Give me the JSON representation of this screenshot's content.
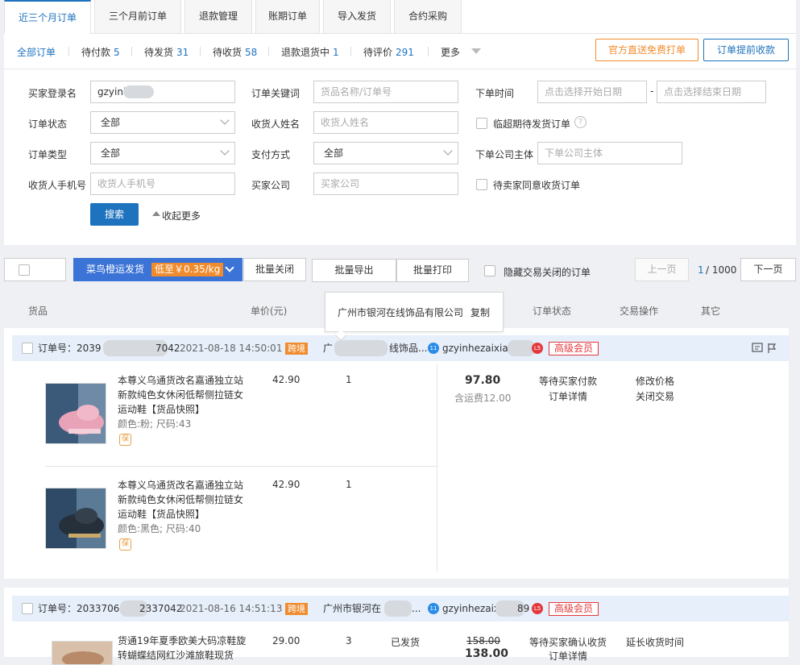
{
  "tabs": [
    {
      "label": "近三个月订单",
      "active": true
    },
    {
      "label": "三个月前订单"
    },
    {
      "label": "退款管理"
    },
    {
      "label": "账期订单"
    },
    {
      "label": "导入发货"
    },
    {
      "label": "合约采购"
    }
  ],
  "status": {
    "all": "全部订单",
    "items": [
      {
        "label": "待付款",
        "count": "5"
      },
      {
        "label": "待发货",
        "count": "31"
      },
      {
        "label": "待收货",
        "count": "58"
      },
      {
        "label": "退款退货中",
        "count": "1"
      },
      {
        "label": "待评价",
        "count": "291"
      }
    ],
    "more": "更多",
    "print_btn": "官方直送免费打单",
    "collect_btn": "订单提前收款"
  },
  "filter": {
    "buyer_login_label": "买家登录名",
    "buyer_login_value": "gzyinh an",
    "keyword_label": "订单关键词",
    "keyword_placeholder": "货品名称/订单号",
    "time_label": "下单时间",
    "start_placeholder": "点击选择开始日期",
    "dash": "-",
    "end_placeholder": "点击选择结束日期",
    "status_label": "订单状态",
    "status_value": "全部",
    "receiver_label": "收货人姓名",
    "receiver_placeholder": "收货人姓名",
    "overdue_label": "临超期待发货订单",
    "help_icon": "?",
    "type_label": "订单类型",
    "type_value": "全部",
    "pay_label": "支付方式",
    "pay_value": "全部",
    "company_label": "下单公司主体",
    "company_placeholder": "下单公司主体",
    "phone_label": "收货人手机号",
    "phone_placeholder": "收货人手机号",
    "buyer_company_label": "买家公司",
    "buyer_company_placeholder": "买家公司",
    "agree_label": "待卖家同意收货订单",
    "search_btn": "搜索",
    "collapse": "收起更多"
  },
  "batch": {
    "cainiao": "菜鸟橙运发货",
    "cainiao_promo": "低至￥0.35/kg",
    "batch_close": "批量关闭",
    "batch_export": "批量导出",
    "batch_print": "批量打印",
    "hide_closed": "隐藏交易关闭的订单",
    "prev": "上一页",
    "page_current": "1",
    "page_total": "/ 1000",
    "next": "下一页"
  },
  "table_head": {
    "goods": "货品",
    "price": "单价(元)",
    "order_status": "订单状态",
    "trade_ops": "交易操作",
    "other": "其它"
  },
  "tooltip": {
    "company": "广州市银河在线饰品有限公司",
    "copy": "复制"
  },
  "orders": [
    {
      "no_label": "订单号：",
      "no_part1": "2039",
      "no_part2": "7042",
      "time": "2021-08-18 14:50:01",
      "tag": "跨境",
      "seller_a": "广",
      "seller_b": "线饰品...",
      "buyer": "gzyinhezaixian",
      "member": "高级会员",
      "items": [
        {
          "title": "本尊义乌通货改名嘉通独立站新款纯色女休闲低帮侧拉链女运动鞋【货品快照】",
          "attrs": "颜色:粉; 尺码:43",
          "price": "42.90",
          "qty": "1",
          "img_color": "#e8a3b8"
        },
        {
          "title": "本尊义乌通货改名嘉通独立站新款纯色女休闲低帮侧拉链女运动鞋【货品快照】",
          "attrs": "颜色:黑色; 尺码:40",
          "price": "42.90",
          "qty": "1",
          "img_color": "#2c3a4a"
        }
      ],
      "total": "97.80",
      "shipping": "含运费12.00",
      "status_main": "等待买家付款",
      "status_detail": "订单详情",
      "op1": "修改价格",
      "op2": "关闭交易"
    },
    {
      "no_label": "订单号：",
      "no_part1": "20337068",
      "no_part2": "2337042",
      "time": "2021-08-16 14:51:13",
      "tag": "跨境",
      "seller_a": "广州市银河在",
      "seller_b": "...",
      "buyer": "gzyinhezaix",
      "buyer_tail": "89",
      "member": "高级会员",
      "items": [
        {
          "title": "货通19年夏季欧美大码凉鞋旋转蝴蝶结网红沙滩旅鞋现货",
          "price": "29.00",
          "qty": "3",
          "ship_status": "已发货",
          "img_color": "#b88a6a"
        }
      ],
      "total_old": "158.00",
      "total": "138.00",
      "status_main": "等待买家确认收货",
      "status_detail": "订单详情",
      "op1": "延长收货时间"
    }
  ],
  "icons": [
    "chevron-down-icon",
    "message-icon",
    "flag-icon",
    "copy-icon"
  ],
  "colors": {
    "primary": "#1e73be",
    "orange": "#f08c2e",
    "red": "#e4393c"
  }
}
